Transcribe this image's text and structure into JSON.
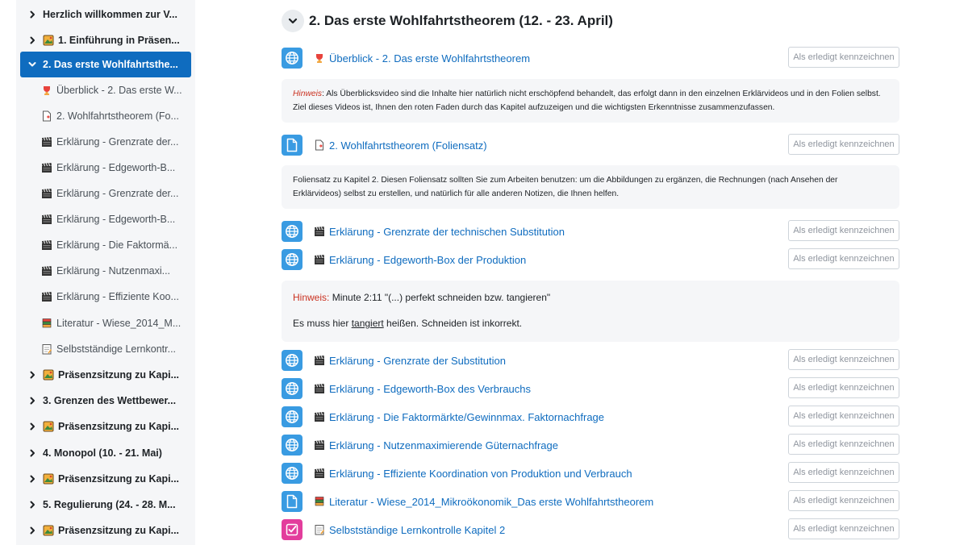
{
  "sidebar": {
    "items": [
      {
        "type": "section",
        "chevron": "›",
        "icon": "",
        "label": "Herzlich willkommen zur V..."
      },
      {
        "type": "section",
        "chevron": "›",
        "icon": "picture-icon",
        "label": "1. Einführung in Präsen..."
      },
      {
        "type": "section",
        "chevron": "⌄",
        "icon": "",
        "label": "2. Das erste Wohlfahrtsthe...",
        "active": true
      },
      {
        "type": "activity",
        "icon": "trophy-icon",
        "label": "Überblick - 2. Das erste W..."
      },
      {
        "type": "activity",
        "icon": "document-icon",
        "label": "2. Wohlfahrtstheorem (Fo..."
      },
      {
        "type": "activity",
        "icon": "clapper-icon",
        "label": "Erklärung - Grenzrate der..."
      },
      {
        "type": "activity",
        "icon": "clapper-icon",
        "label": "Erklärung - Edgeworth-B..."
      },
      {
        "type": "activity",
        "icon": "clapper-icon",
        "label": "Erklärung - Grenzrate der..."
      },
      {
        "type": "activity",
        "icon": "clapper-icon",
        "label": "Erklärung - Edgeworth-B..."
      },
      {
        "type": "activity",
        "icon": "clapper-icon",
        "label": "Erklärung - Die Faktormä..."
      },
      {
        "type": "activity",
        "icon": "clapper-icon",
        "label": "Erklärung - Nutzenmaxi..."
      },
      {
        "type": "activity",
        "icon": "clapper-icon",
        "label": "Erklärung - Effiziente Koo..."
      },
      {
        "type": "activity",
        "icon": "book-icon",
        "label": "Literatur - Wiese_2014_M..."
      },
      {
        "type": "activity",
        "icon": "notepad-icon",
        "label": "Selbstständige Lernkontr..."
      },
      {
        "type": "section",
        "chevron": "›",
        "icon": "picture-icon",
        "label": "Präsenzsitzung zu Kapi..."
      },
      {
        "type": "section",
        "chevron": "›",
        "icon": "",
        "label": "3. Grenzen des Wettbewer..."
      },
      {
        "type": "section",
        "chevron": "›",
        "icon": "picture-icon",
        "label": "Präsenzsitzung zu Kapi..."
      },
      {
        "type": "section",
        "chevron": "›",
        "icon": "",
        "label": "4. Monopol (10. - 21. Mai)"
      },
      {
        "type": "section",
        "chevron": "›",
        "icon": "picture-icon",
        "label": "Präsenzsitzung zu Kapi..."
      },
      {
        "type": "section",
        "chevron": "›",
        "icon": "",
        "label": "5. Regulierung (24. - 28. M..."
      },
      {
        "type": "section",
        "chevron": "›",
        "icon": "picture-icon",
        "label": "Präsenzsitzung zu Kapi..."
      }
    ]
  },
  "main": {
    "section_title": "2. Das erste Wohlfahrtstheorem (12. - 23. April)",
    "complete_label": "Als erledigt kennzeichnen",
    "activities": [
      {
        "kind": "url",
        "emoji": "trophy-icon",
        "label": "Überblick - 2. Das erste Wohlfahrtstheorem"
      },
      {
        "kind": "file",
        "emoji": "document-icon",
        "label": "2. Wohlfahrtstheorem (Foliensatz)"
      },
      {
        "kind": "url",
        "emoji": "clapper-icon",
        "label": "Erklärung - Grenzrate der technischen Substitution"
      },
      {
        "kind": "url",
        "emoji": "clapper-icon",
        "label": "Erklärung - Edgeworth-Box der Produktion"
      },
      {
        "kind": "url",
        "emoji": "clapper-icon",
        "label": "Erklärung - Grenzrate der Substitution"
      },
      {
        "kind": "url",
        "emoji": "clapper-icon",
        "label": "Erklärung - Edgeworth-Box des Verbrauchs"
      },
      {
        "kind": "url",
        "emoji": "clapper-icon",
        "label": "Erklärung - Die Faktormärkte/Gewinnmax. Faktornachfrage"
      },
      {
        "kind": "url",
        "emoji": "clapper-icon",
        "label": "Erklärung - Nutzenmaximierende Güternachfrage"
      },
      {
        "kind": "url",
        "emoji": "clapper-icon",
        "label": "Erklärung - Effiziente Koordination von Produktion und Verbrauch"
      },
      {
        "kind": "file",
        "emoji": "book-icon",
        "label": "Literatur - Wiese_2014_Mikroökonomik_Das erste Wohlfahrtstheorem"
      },
      {
        "kind": "quiz",
        "emoji": "notepad-icon",
        "label": "Selbstständige Lernkontrolle Kapitel 2"
      }
    ],
    "desc1": {
      "hint_label": "Hinweis",
      "text": ": Als Überblicksvideo sind die Inhalte hier natürlich nicht erschöpfend behandelt, das erfolgt dann in den einzelnen Erklärvideos und in den Folien selbst. Ziel dieses Videos ist, Ihnen den roten Faden durch das Kapitel aufzuzeigen und die wichtigsten Erkenntnisse zusammenzufassen."
    },
    "desc2": {
      "text": "Foliensatz zu Kapitel 2. Diesen Foliensatz sollten Sie zum Arbeiten benutzen: um die Abbildungen zu ergänzen, die Rechnungen (nach Ansehen der Erklärvideos) selbst zu erstellen, und natürlich für alle anderen Notizen, die Ihnen helfen."
    },
    "desc3": {
      "hint_label": "Hinweis:",
      "line1": " Minute 2:11 \"(...) perfekt schneiden bzw. tangieren\"",
      "line2_a": "Es muss hier ",
      "line2_u": "tangiert",
      "line2_b": " heißen. Schneiden ist inkorrekt."
    }
  },
  "colors": {
    "primary": "#0f6cbf",
    "sidebar_bg": "#f5f6f8",
    "url_icon_bg": "#399be2",
    "quiz_icon_bg": "#e33d9c",
    "hint_red": "#ca3120"
  }
}
